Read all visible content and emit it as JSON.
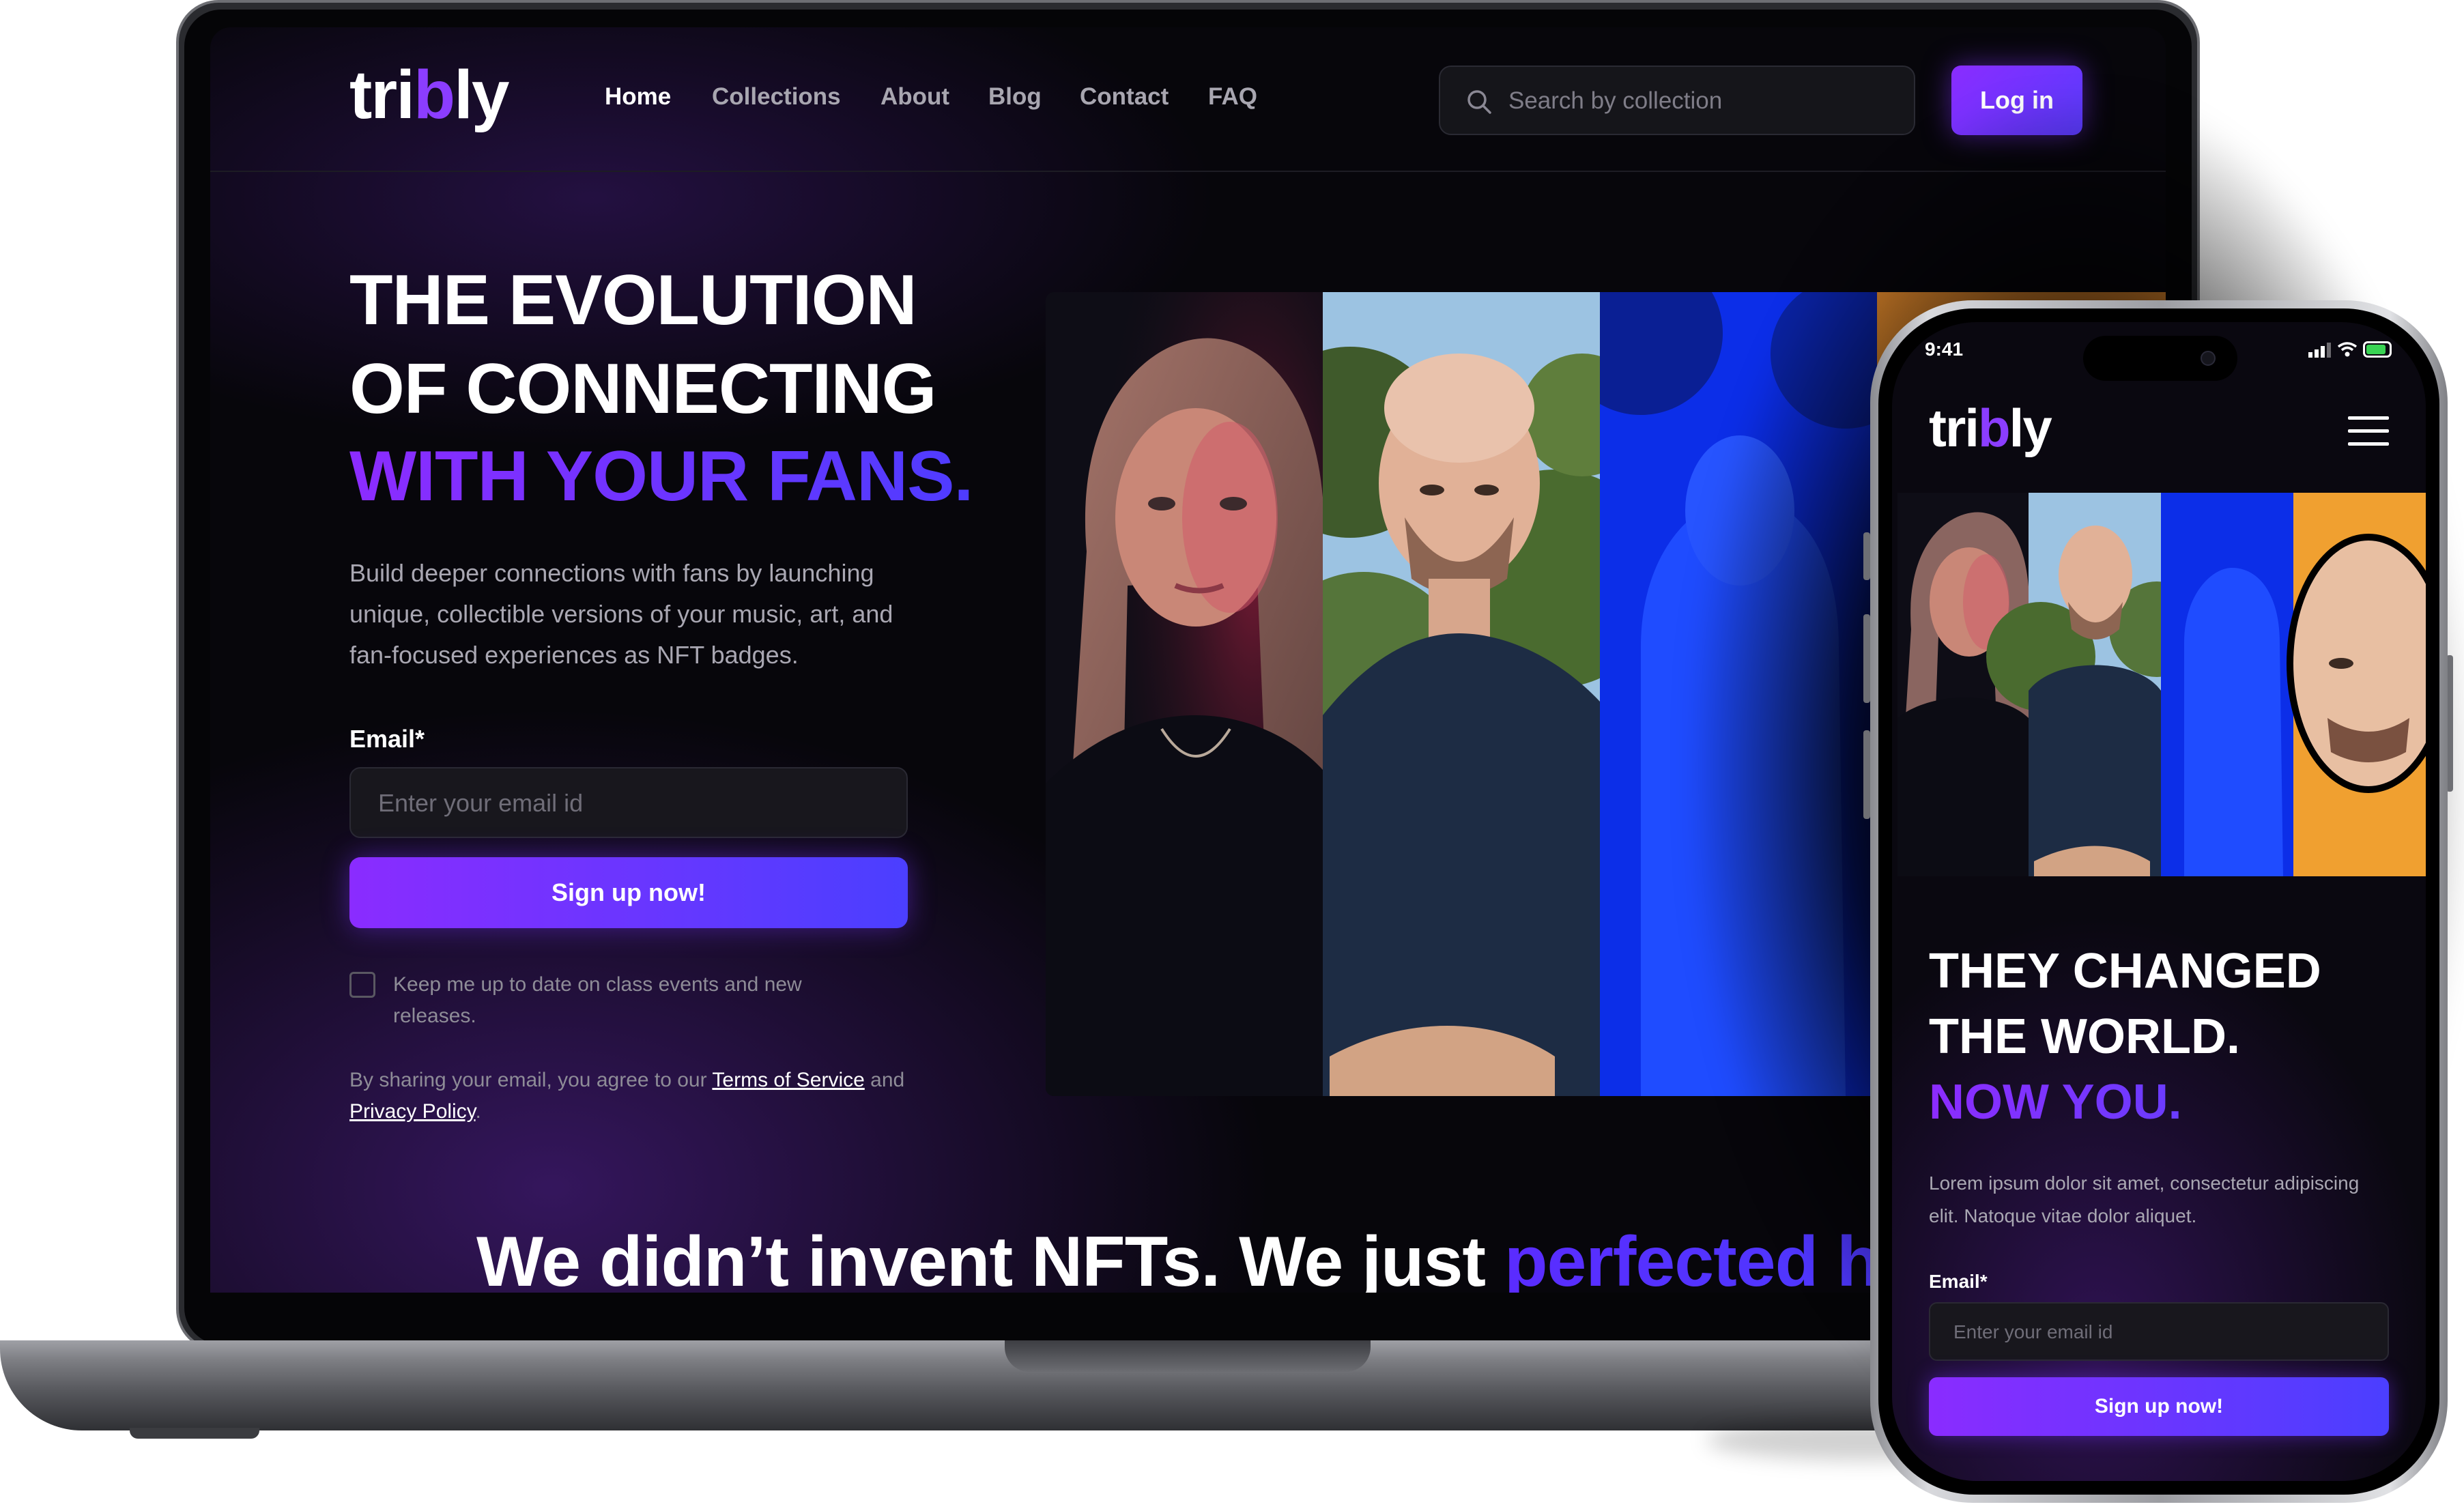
{
  "desktop": {
    "logo": {
      "prefix": "tri",
      "highlight": "b",
      "suffix": "ly"
    },
    "nav": {
      "home": "Home",
      "collections": "Collections",
      "about": "About",
      "blog": "Blog",
      "contact": "Contact",
      "faq": "FAQ"
    },
    "search": {
      "placeholder": "Search by collection"
    },
    "login_label": "Log in",
    "hero": {
      "line1": "THE EVOLUTION",
      "line2": "OF CONNECTING",
      "line3": "WITH YOUR FANS.",
      "description": "Build deeper connections with fans by launching unique, collectible versions of your music, art, and fan-focused experiences as NFT badges."
    },
    "form": {
      "email_label": "Email*",
      "email_placeholder": "Enter your email id",
      "signup_label": "Sign up now!",
      "keep_updated": "Keep me up to date on class events and new releases.",
      "legal_prefix": "By sharing your email, you agree to our ",
      "terms": "Terms of Service",
      "legal_and": " and ",
      "privacy": "Privacy Policy",
      "legal_end": "."
    },
    "tagline": {
      "plain": "We didn’t invent NFTs. We just ",
      "highlight": "perfected how"
    }
  },
  "mobile": {
    "time": "9:41",
    "logo": {
      "prefix": "tri",
      "highlight": "b",
      "suffix": "ly"
    },
    "hero": {
      "line1": "THEY CHANGED",
      "line2": "THE WORLD.",
      "line3": "NOW YOU.",
      "description": "Lorem ipsum dolor sit amet, consectetur adipiscing elit. Natoque vitae dolor aliquet."
    },
    "form": {
      "email_label": "Email*",
      "email_placeholder": "Enter your email id",
      "signup_label": "Sign up now!"
    }
  },
  "colors": {
    "accent_purple": "#8a2cff",
    "accent_blue": "#4b3fff",
    "background": "#07060b"
  },
  "icons": [
    "search-icon",
    "menu-icon",
    "signal-icon",
    "wifi-icon",
    "battery-icon",
    "camera-icon"
  ]
}
